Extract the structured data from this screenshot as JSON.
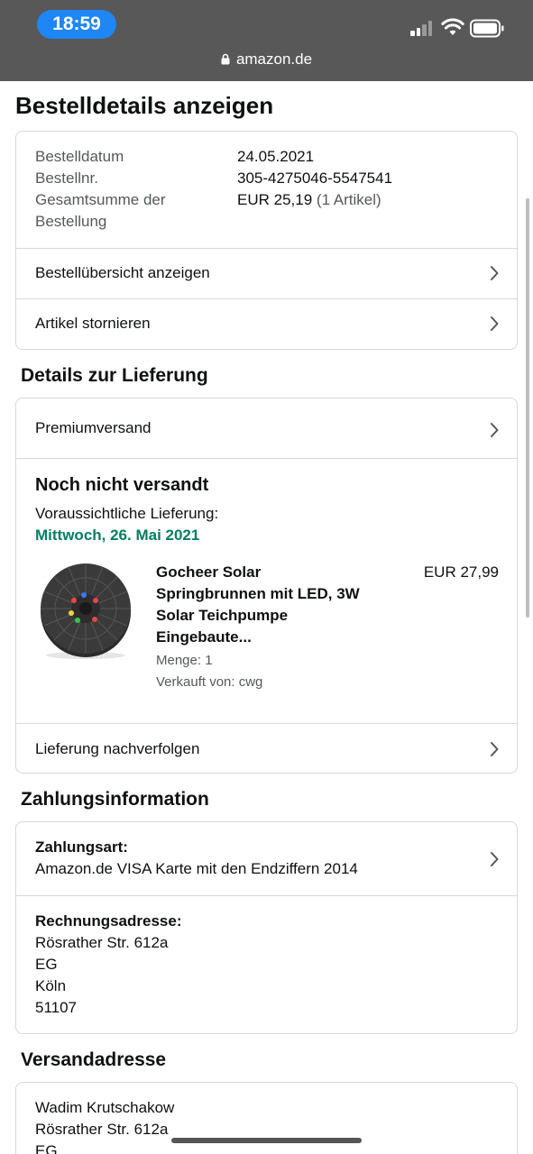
{
  "status": {
    "time": "18:59",
    "url": "amazon.de"
  },
  "page": {
    "title": "Bestelldetails anzeigen"
  },
  "order": {
    "date_label": "Bestelldatum",
    "date_value": "24.05.2021",
    "number_label": "Bestellnr.",
    "number_value": "305-4275046-5547541",
    "total_label_1": "Gesamtsumme der",
    "total_label_2": "Bestellung",
    "total_value": "EUR 25,19",
    "total_items": "(1 Artikel)",
    "overview_label": "Bestellübersicht anzeigen",
    "cancel_label": "Artikel stornieren"
  },
  "delivery": {
    "section_title": "Details zur Lieferung",
    "method_label": "Premiumversand",
    "status": "Noch nicht versandt",
    "expected_label": "Voraussichtliche Lieferung:",
    "expected_date": "Mittwoch, 26. Mai 2021",
    "product": {
      "title_1": "Gocheer Solar",
      "title_2": "Springbrunnen mit LED, 3W",
      "title_3": "Solar Teichpumpe",
      "title_4": "Eingebaute...",
      "price": "EUR 27,99",
      "quantity": "Menge: 1",
      "seller": "Verkauft von: cwg"
    },
    "track_label": "Lieferung nachverfolgen"
  },
  "payment": {
    "section_title": "Zahlungsinformation",
    "method_label": "Zahlungsart:",
    "method_value": "Amazon.de VISA Karte mit den Endziffern 2014",
    "billing_label": "Rechnungsadresse:",
    "billing_lines": [
      "Rösrather Str. 612a",
      "EG",
      "Köln",
      "51107"
    ]
  },
  "shipping": {
    "section_title": "Versandadresse",
    "lines": [
      "Wadim Krutschakow",
      "Rösrather Str. 612a",
      "EG"
    ]
  },
  "colors": {
    "delivery_green": "#067d62",
    "statusbar": "#585858",
    "time_pill": "#1e86f5"
  },
  "icons": [
    "lock-icon",
    "chevron-right-icon",
    "signal-icon",
    "wifi-icon",
    "battery-icon"
  ]
}
